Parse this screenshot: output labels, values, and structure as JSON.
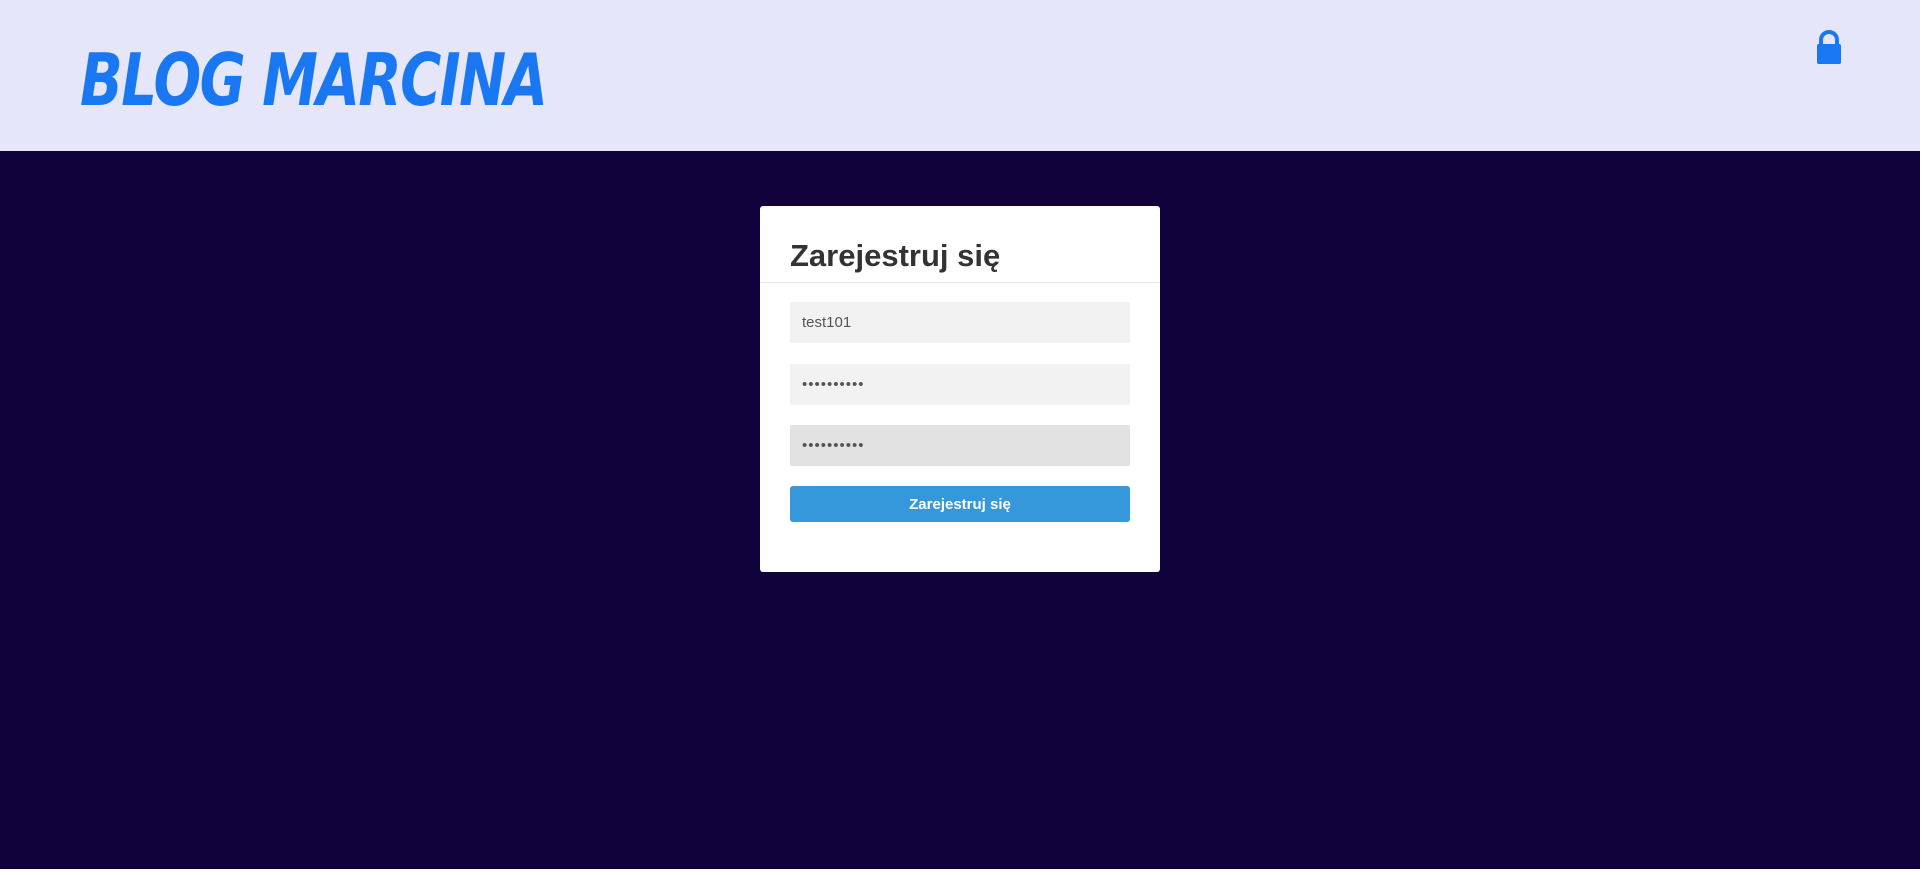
{
  "header": {
    "logo_text": "Blog Marcina",
    "lock_icon": "lock-icon",
    "accent_color": "#1a77f2",
    "background_color": "#e5e6fa"
  },
  "main": {
    "background_color": "#10023a"
  },
  "register_form": {
    "title": "Zarejestruj się",
    "username_value": "test101",
    "password_value": "••••••••••",
    "password_confirm_value": "••••••••••",
    "submit_label": "Zarejestruj się",
    "button_color": "#3498db"
  }
}
